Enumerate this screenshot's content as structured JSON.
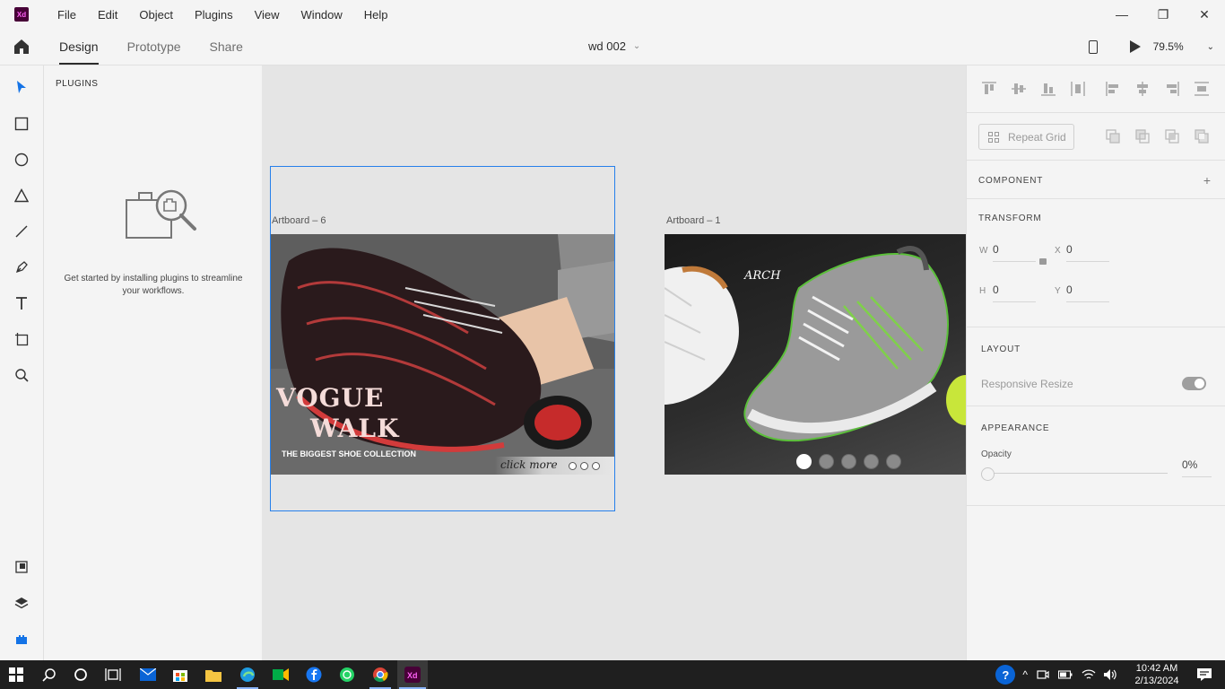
{
  "app": {
    "icon_label": "Xd"
  },
  "menu": [
    "File",
    "Edit",
    "Object",
    "Plugins",
    "View",
    "Window",
    "Help"
  ],
  "window_controls": {
    "minimize": "—",
    "restore": "❐",
    "close": "✕"
  },
  "tabs": [
    {
      "label": "Design",
      "active": true
    },
    {
      "label": "Prototype",
      "active": false
    },
    {
      "label": "Share",
      "active": false
    }
  ],
  "document": {
    "title": "wd 002"
  },
  "zoom": {
    "value": "79.5%"
  },
  "plugins_panel": {
    "title": "PLUGINS",
    "message": "Get started by installing plugins to streamline your workflows."
  },
  "canvas": {
    "artboards": [
      {
        "label": "Artboard – 6",
        "headline_1": "VOGUE",
        "headline_2": "WALK",
        "tagline": "THE BIGGEST SHOE COLLECTION",
        "cta": "click more"
      },
      {
        "label": "Artboard – 1",
        "brand": "ARCH",
        "carousel_active_index": 0
      }
    ]
  },
  "inspector": {
    "repeat_grid_label": "Repeat Grid",
    "component_title": "COMPONENT",
    "transform_title": "TRANSFORM",
    "transform": {
      "w_label": "W",
      "w_value": "0",
      "h_label": "H",
      "h_value": "0",
      "x_label": "X",
      "x_value": "0",
      "y_label": "Y",
      "y_value": "0"
    },
    "layout_title": "LAYOUT",
    "responsive_resize_label": "Responsive Resize",
    "appearance_title": "APPEARANCE",
    "opacity_label": "Opacity",
    "opacity_value": "0%"
  },
  "taskbar": {
    "time": "10:42 AM",
    "date": "2/13/2024"
  },
  "colors": {
    "selection": "#2680eb",
    "xd_brand": "#470137",
    "xd_accent": "#ff61f6",
    "toolbar_active": "#1473e6"
  }
}
